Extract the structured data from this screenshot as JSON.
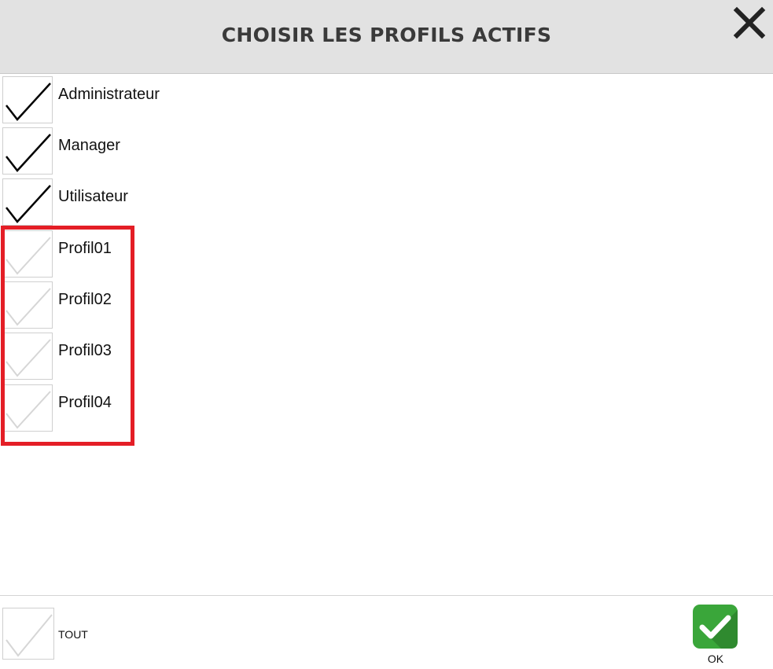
{
  "dialog": {
    "title": "CHOISIR LES PROFILS ACTIFS",
    "close_icon": "close-icon"
  },
  "profiles": [
    {
      "label": "Administrateur",
      "checked": true
    },
    {
      "label": "Manager",
      "checked": true
    },
    {
      "label": "Utilisateur",
      "checked": true
    },
    {
      "label": "Profil01",
      "checked": false
    },
    {
      "label": "Profil02",
      "checked": false
    },
    {
      "label": "Profil03",
      "checked": false
    },
    {
      "label": "Profil04",
      "checked": false
    }
  ],
  "footer": {
    "select_all_label": "TOUT",
    "select_all_checked": false,
    "ok_label": "OK"
  },
  "colors": {
    "header_bg": "#e2e2e2",
    "highlight_border": "#e41e26",
    "ok_green": "#3aa63a",
    "checked_mark": "#000000",
    "unchecked_mark": "#d6d6d6"
  }
}
